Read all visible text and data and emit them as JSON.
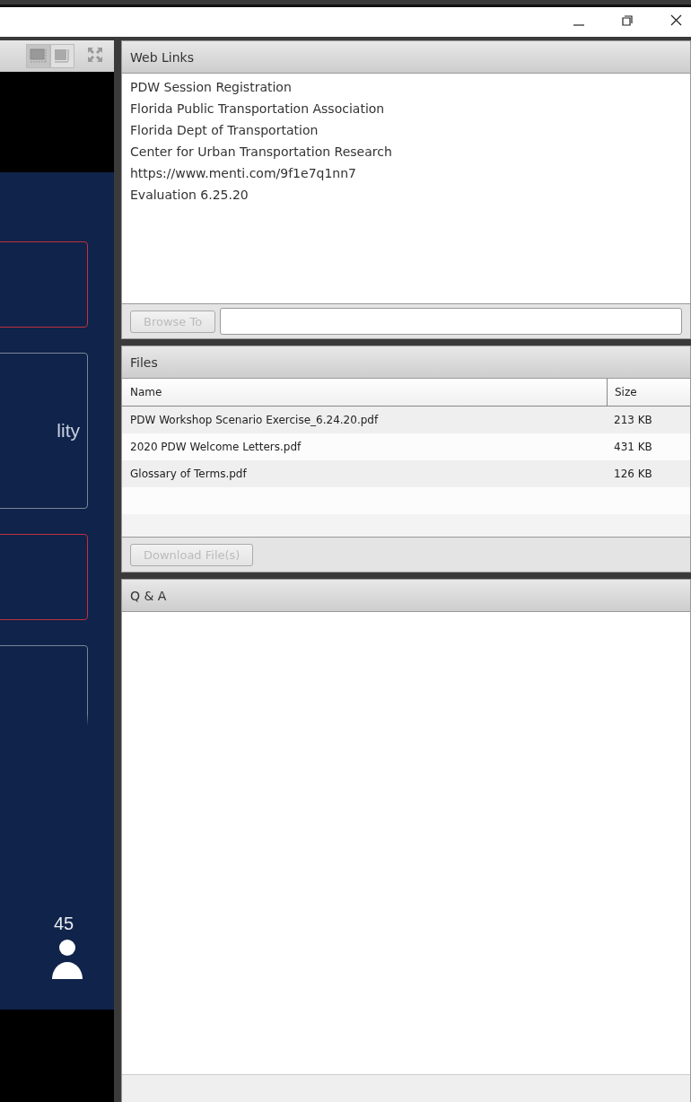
{
  "stage": {
    "layout_buttons": [
      {
        "selected": true
      },
      {
        "selected": false
      }
    ],
    "slide": {
      "cards": [
        {
          "kind": "closed",
          "color": "#c0313e"
        },
        {
          "kind": "closed",
          "color": "#7a8699",
          "text": "lity"
        },
        {
          "kind": "closed",
          "color": "#c0313e"
        },
        {
          "kind": "open",
          "color": "#7a8699"
        }
      ],
      "attendee_count": "45"
    }
  },
  "web_links": {
    "title": "Web Links",
    "links": [
      "PDW Session Registration",
      "Florida Public Transportation Association",
      "Florida Dept of Transportation",
      "Center for Urban Transportation Research",
      "https://www.menti.com/9f1e7q1nn7",
      "Evaluation 6.25.20"
    ],
    "browse_button": "Browse To",
    "disabled": true
  },
  "files": {
    "title": "Files",
    "columns": [
      "Name",
      "Size"
    ],
    "rows": [
      [
        "PDW Workshop Scenario Exercise_6.24.20.pdf",
        "213 KB"
      ],
      [
        "2020 PDW Welcome Letters.pdf",
        "431 KB"
      ],
      [
        "Glossary of Terms.pdf",
        "126 KB"
      ]
    ],
    "download_button": "Download File(s)",
    "disabled": true
  },
  "qa": {
    "title": "Q & A"
  }
}
